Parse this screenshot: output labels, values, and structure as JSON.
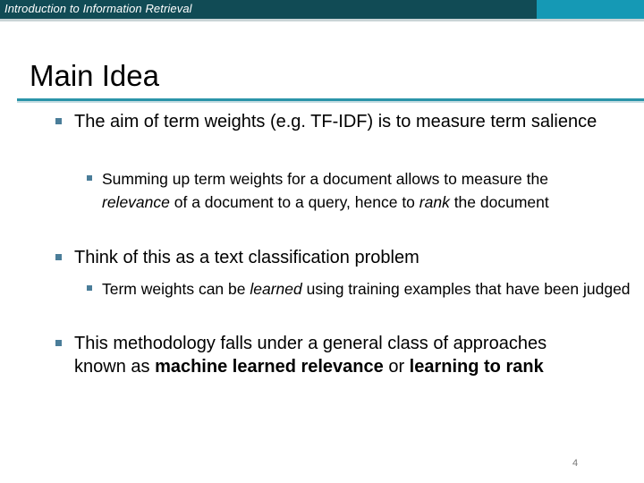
{
  "header": {
    "title": "Introduction to Information Retrieval",
    "colors": {
      "bar": "#114b55",
      "accent": "#1599b5"
    }
  },
  "slide": {
    "title": "Main Idea",
    "bullets": [
      {
        "level": 1,
        "parts": [
          "The aim of term weights (e.g. TF-IDF) is to measure term salience"
        ]
      },
      {
        "level": 2,
        "parts": [
          "Summing up term weights for a document allows to measure the ",
          "relevance",
          " of a document to a query, hence to ",
          "rank",
          " the document"
        ]
      },
      {
        "level": 1,
        "parts": [
          "Think of this as a text classification problem"
        ]
      },
      {
        "level": 2,
        "parts": [
          "Term weights can be ",
          "learned",
          " using training examples that have been judged"
        ]
      },
      {
        "level": 1,
        "parts": [
          "This methodology falls under a general class of approaches known as ",
          "machine learned relevance",
          " or ",
          "learning to rank"
        ]
      }
    ],
    "page_number": "4"
  }
}
